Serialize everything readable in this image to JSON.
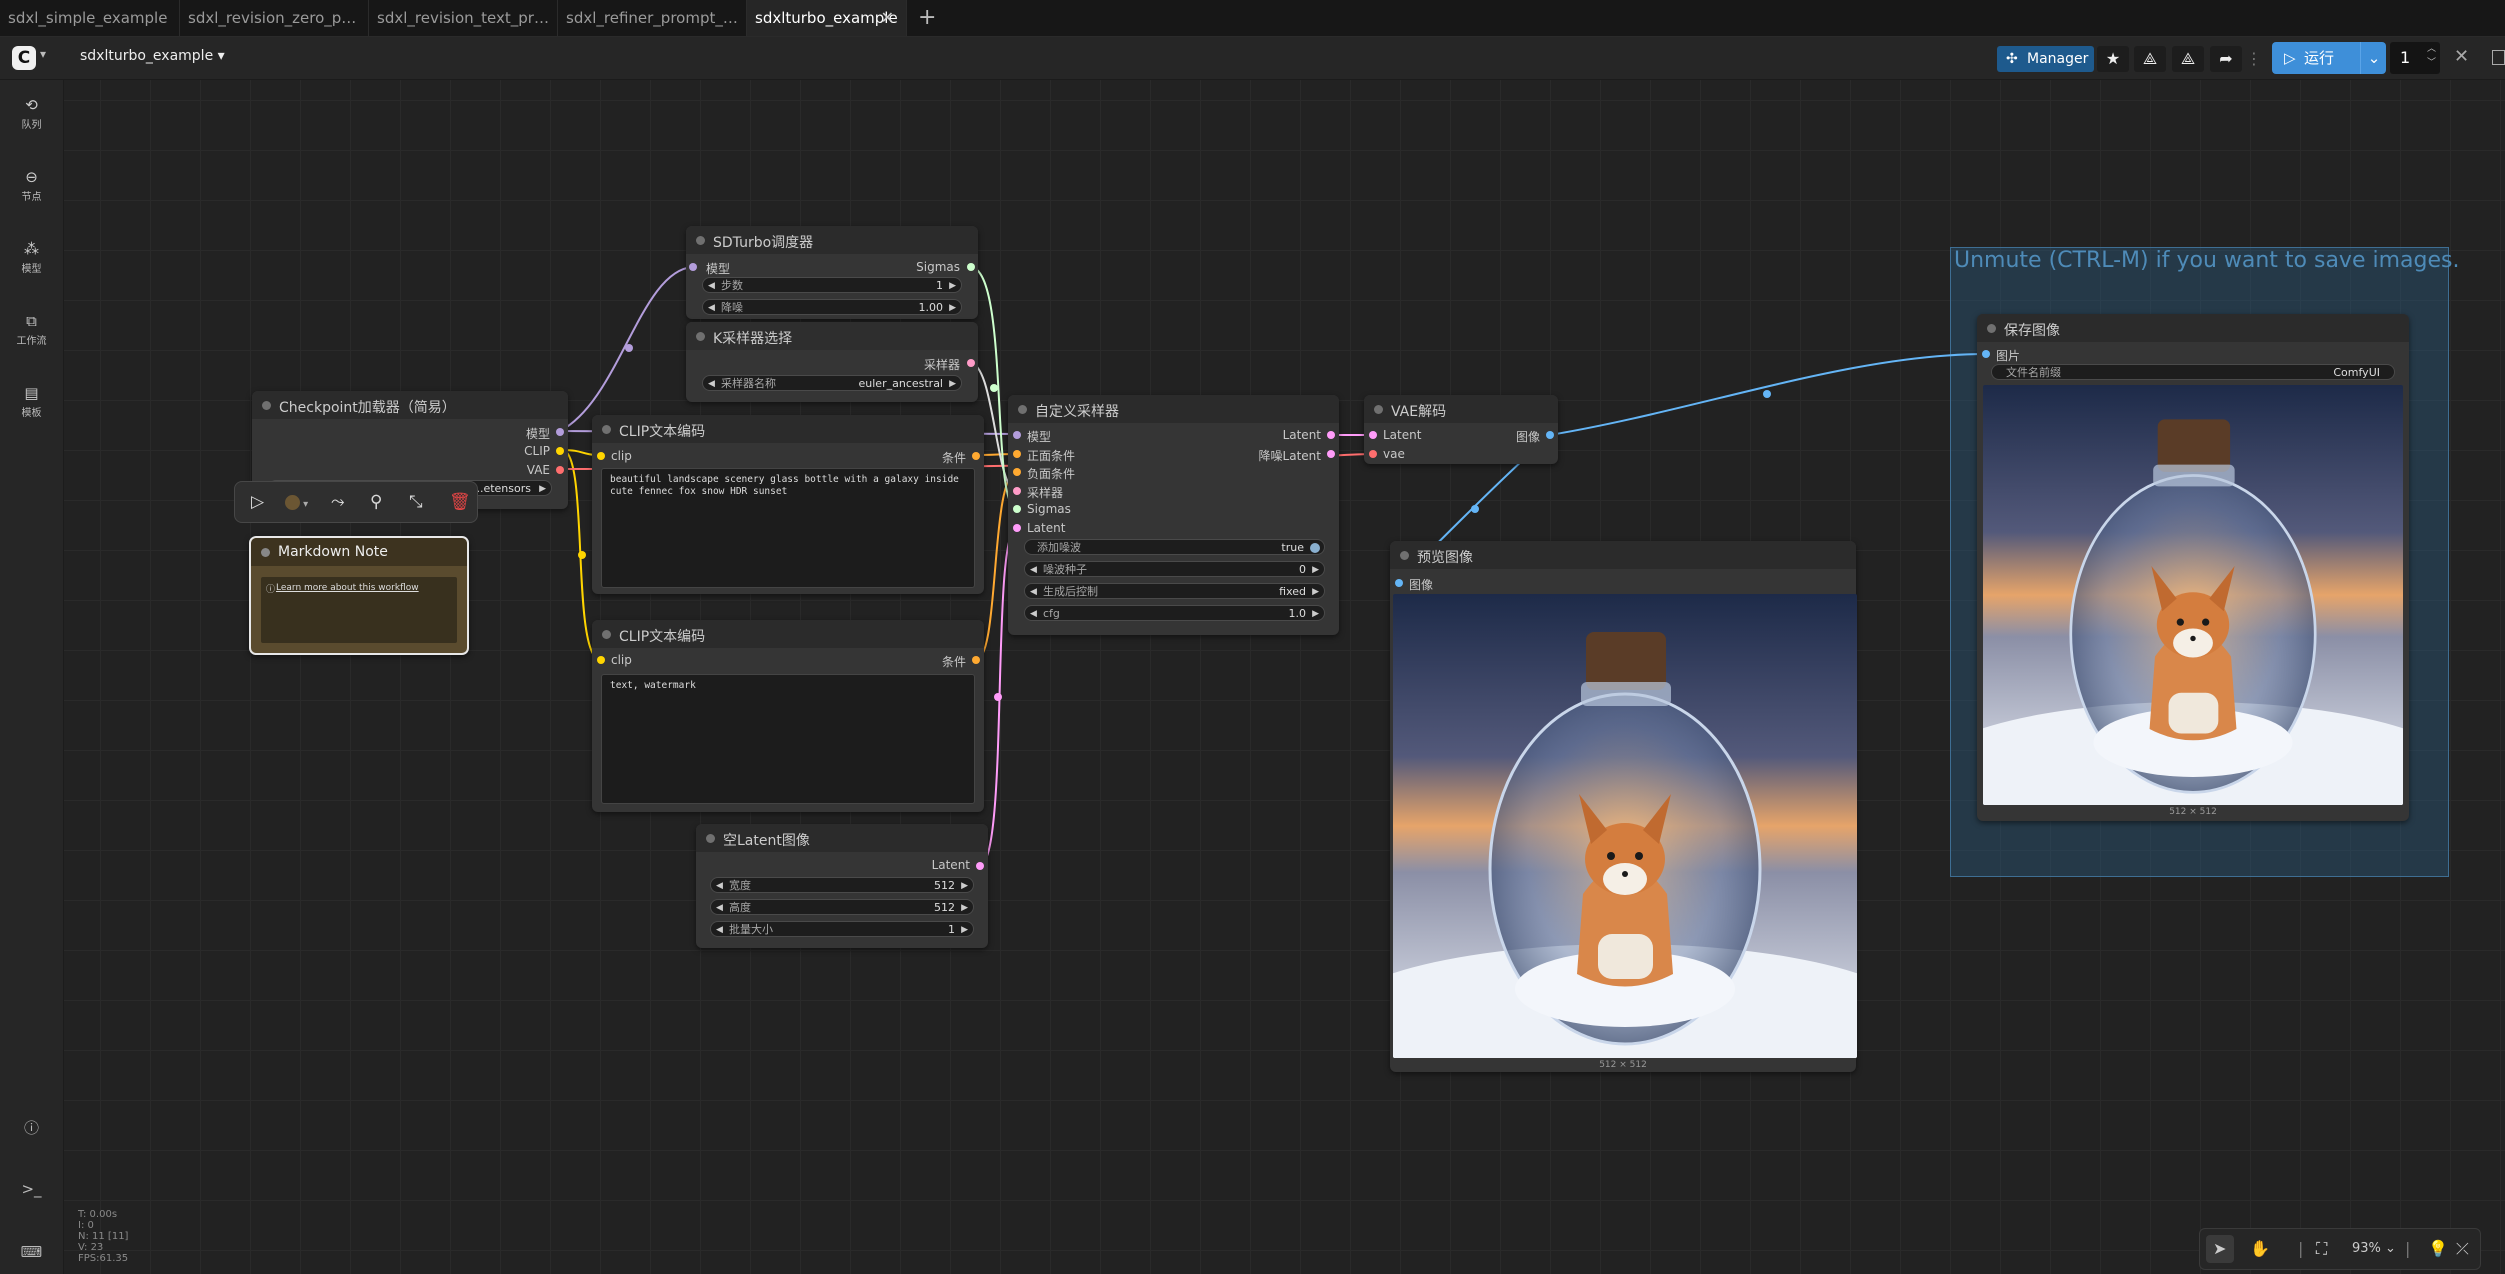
{
  "tabs": [
    {
      "label": "sdxl_simple_example",
      "active": false
    },
    {
      "label": "sdxl_revision_zero_p…",
      "active": false
    },
    {
      "label": "sdxl_revision_text_pr…",
      "active": false
    },
    {
      "label": "sdxl_refiner_prompt_…",
      "active": false
    },
    {
      "label": "sdxlturbo_example",
      "active": true
    }
  ],
  "menubar": {
    "workflow_name": "sdxlturbo_example",
    "manager_label": "Manager",
    "run_label": "运行",
    "queue_count": "1"
  },
  "sidebar": [
    {
      "label": "队列",
      "icon": "history-icon"
    },
    {
      "label": "节点",
      "icon": "node-icon"
    },
    {
      "label": "模型",
      "icon": "model-icon"
    },
    {
      "label": "工作流",
      "icon": "workflow-icon"
    },
    {
      "label": "模板",
      "icon": "template-icon"
    }
  ],
  "nodes": {
    "sdturbo": {
      "title": "SDTurbo调度器",
      "input_model": "模型",
      "output": "Sigmas",
      "steps_label": "步数",
      "steps_value": "1",
      "denoise_label": "降噪",
      "denoise_value": "1.00"
    },
    "ksampler_select": {
      "title": "K采样器选择",
      "output": "采样器",
      "name_label": "采样器名称",
      "name_value": "euler_ancestral"
    },
    "checkpoint": {
      "title": "Checkpoint加载器（简易）",
      "out_model": "模型",
      "out_clip": "CLIP",
      "out_vae": "VAE",
      "ckpt_value": "...etensors"
    },
    "clip_pos": {
      "title": "CLIP文本编码",
      "input": "clip",
      "output": "条件",
      "text": "beautiful landscape scenery glass bottle with a galaxy inside cute fennec fox snow HDR sunset"
    },
    "clip_neg": {
      "title": "CLIP文本编码",
      "input": "clip",
      "output": "条件",
      "text": "text, watermark"
    },
    "markdown": {
      "title": "Markdown Note",
      "link": "Learn more about this workflow"
    },
    "custom_sampler": {
      "title": "自定义采样器",
      "in_model": "模型",
      "in_pos": "正面条件",
      "in_neg": "负面条件",
      "in_sampler": "采样器",
      "in_sigmas": "Sigmas",
      "in_latent": "Latent",
      "out_latent": "Latent",
      "out_denoised": "降噪Latent",
      "add_noise_label": "添加噪波",
      "add_noise_value": "true",
      "seed_label": "噪波种子",
      "seed_value": "0",
      "control_label": "生成后控制",
      "control_value": "fixed",
      "cfg_label": "cfg",
      "cfg_value": "1.0"
    },
    "empty_latent": {
      "title": "空Latent图像",
      "output": "Latent",
      "width_label": "宽度",
      "width_value": "512",
      "height_label": "高度",
      "height_value": "512",
      "batch_label": "批量大小",
      "batch_value": "1"
    },
    "vae_decode": {
      "title": "VAE解码",
      "in_latent": "Latent",
      "in_vae": "vae",
      "output": "图像"
    },
    "preview": {
      "title": "预览图像",
      "input": "图像",
      "caption": "512 × 512"
    },
    "save": {
      "title": "保存图像",
      "input": "图片",
      "prefix_label": "文件名前缀",
      "prefix_value": "ComfyUI",
      "caption": "512 × 512"
    }
  },
  "group": {
    "title": "Unmute (CTRL-M) if you want to save images."
  },
  "stats": [
    "T: 0.00s",
    "I: 0",
    "N: 11 [11]",
    "V: 23",
    "FPS:61.35"
  ],
  "zoom": "93%",
  "colors": {
    "accent": "#3e8fd9",
    "manager": "#1e5a8d",
    "link_model": "#b39ddb",
    "link_clip": "#ffd500",
    "link_vae": "#ff6e6e",
    "link_latent": "#ff9cf9",
    "link_sigmas": "#cdffcd",
    "link_image": "#64b5f6",
    "link_conditioning": "#ffa931"
  }
}
